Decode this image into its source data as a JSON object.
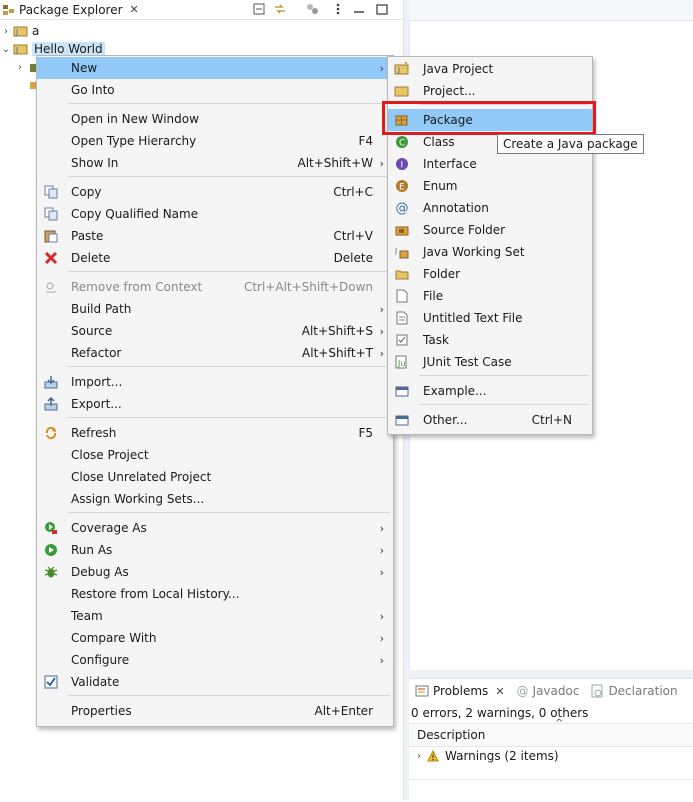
{
  "explorer": {
    "tab_title": "Package Explorer",
    "tree": [
      {
        "label": "a",
        "expanded": false
      },
      {
        "label": "Hello World",
        "expanded": true,
        "selected": true
      }
    ]
  },
  "context_menu": {
    "items": [
      {
        "label": "New",
        "accel": "",
        "submenu": true,
        "icon": "none",
        "highlighted": true
      },
      {
        "label": "Go Into",
        "accel": "",
        "submenu": false,
        "icon": "none"
      },
      {
        "label": "Open in New Window",
        "accel": "",
        "submenu": false,
        "icon": "none"
      },
      {
        "label": "Open Type Hierarchy",
        "accel": "F4",
        "submenu": false,
        "icon": "none"
      },
      {
        "label": "Show In",
        "accel": "Alt+Shift+W",
        "submenu": true,
        "icon": "none"
      },
      {
        "label": "Copy",
        "accel": "Ctrl+C",
        "submenu": false,
        "icon": "copy-icon"
      },
      {
        "label": "Copy Qualified Name",
        "accel": "",
        "submenu": false,
        "icon": "copy-qualified-name-icon"
      },
      {
        "label": "Paste",
        "accel": "Ctrl+V",
        "submenu": false,
        "icon": "paste-icon"
      },
      {
        "label": "Delete",
        "accel": "Delete",
        "submenu": false,
        "icon": "delete-icon"
      },
      {
        "label": "Remove from Context",
        "accel": "Ctrl+Alt+Shift+Down",
        "submenu": false,
        "icon": "remove-context-icon",
        "disabled": true
      },
      {
        "label": "Build Path",
        "accel": "",
        "submenu": true,
        "icon": "none"
      },
      {
        "label": "Source",
        "accel": "Alt+Shift+S",
        "submenu": true,
        "icon": "none"
      },
      {
        "label": "Refactor",
        "accel": "Alt+Shift+T",
        "submenu": true,
        "icon": "none"
      },
      {
        "label": "Import...",
        "accel": "",
        "submenu": false,
        "icon": "import-icon"
      },
      {
        "label": "Export...",
        "accel": "",
        "submenu": false,
        "icon": "export-icon"
      },
      {
        "label": "Refresh",
        "accel": "F5",
        "submenu": false,
        "icon": "refresh-icon"
      },
      {
        "label": "Close Project",
        "accel": "",
        "submenu": false,
        "icon": "none"
      },
      {
        "label": "Close Unrelated Project",
        "accel": "",
        "submenu": false,
        "icon": "none"
      },
      {
        "label": "Assign Working Sets...",
        "accel": "",
        "submenu": false,
        "icon": "none"
      },
      {
        "label": "Coverage As",
        "accel": "",
        "submenu": true,
        "icon": "coverage-icon"
      },
      {
        "label": "Run As",
        "accel": "",
        "submenu": true,
        "icon": "run-icon"
      },
      {
        "label": "Debug As",
        "accel": "",
        "submenu": true,
        "icon": "debug-icon"
      },
      {
        "label": "Restore from Local History...",
        "accel": "",
        "submenu": false,
        "icon": "none"
      },
      {
        "label": "Team",
        "accel": "",
        "submenu": true,
        "icon": "none"
      },
      {
        "label": "Compare With",
        "accel": "",
        "submenu": true,
        "icon": "none"
      },
      {
        "label": "Configure",
        "accel": "",
        "submenu": true,
        "icon": "none"
      },
      {
        "label": "Validate",
        "accel": "",
        "submenu": false,
        "icon": "validate-check-icon"
      },
      {
        "label": "Properties",
        "accel": "Alt+Enter",
        "submenu": false,
        "icon": "none"
      }
    ]
  },
  "new_submenu": {
    "items": [
      {
        "label": "Java Project",
        "accel": "",
        "icon": "java-project-icon"
      },
      {
        "label": "Project...",
        "accel": "",
        "icon": "project-icon"
      },
      {
        "label": "Package",
        "accel": "",
        "icon": "package-icon",
        "highlighted": true
      },
      {
        "label": "Class",
        "accel": "",
        "icon": "class-icon"
      },
      {
        "label": "Interface",
        "accel": "",
        "icon": "interface-icon"
      },
      {
        "label": "Enum",
        "accel": "",
        "icon": "enum-icon"
      },
      {
        "label": "Annotation",
        "accel": "",
        "icon": "annotation-icon"
      },
      {
        "label": "Source Folder",
        "accel": "",
        "icon": "source-folder-icon"
      },
      {
        "label": "Java Working Set",
        "accel": "",
        "icon": "working-set-icon"
      },
      {
        "label": "Folder",
        "accel": "",
        "icon": "folder-icon"
      },
      {
        "label": "File",
        "accel": "",
        "icon": "file-icon"
      },
      {
        "label": "Untitled Text File",
        "accel": "",
        "icon": "text-file-icon"
      },
      {
        "label": "Task",
        "accel": "",
        "icon": "task-icon"
      },
      {
        "label": "JUnit Test Case",
        "accel": "",
        "icon": "junit-icon"
      },
      {
        "label": "Example...",
        "accel": "",
        "icon": "example-icon"
      },
      {
        "label": "Other...",
        "accel": "Ctrl+N",
        "icon": "other-icon"
      }
    ],
    "tooltip": "Create a Java package"
  },
  "problems": {
    "tabs": [
      {
        "label": "Problems",
        "active": true
      },
      {
        "label": "Javadoc",
        "active": false
      },
      {
        "label": "Declaration",
        "active": false
      }
    ],
    "summary": "0 errors, 2 warnings, 0 others",
    "column_header": "Description",
    "rows": [
      {
        "label": "Warnings (2 items)"
      }
    ]
  },
  "colors": {
    "highlight": "#91c9f7",
    "menu_bg": "#f5f5f5",
    "annotation_box": "#e01b1b",
    "selection": "#cce4f7"
  }
}
